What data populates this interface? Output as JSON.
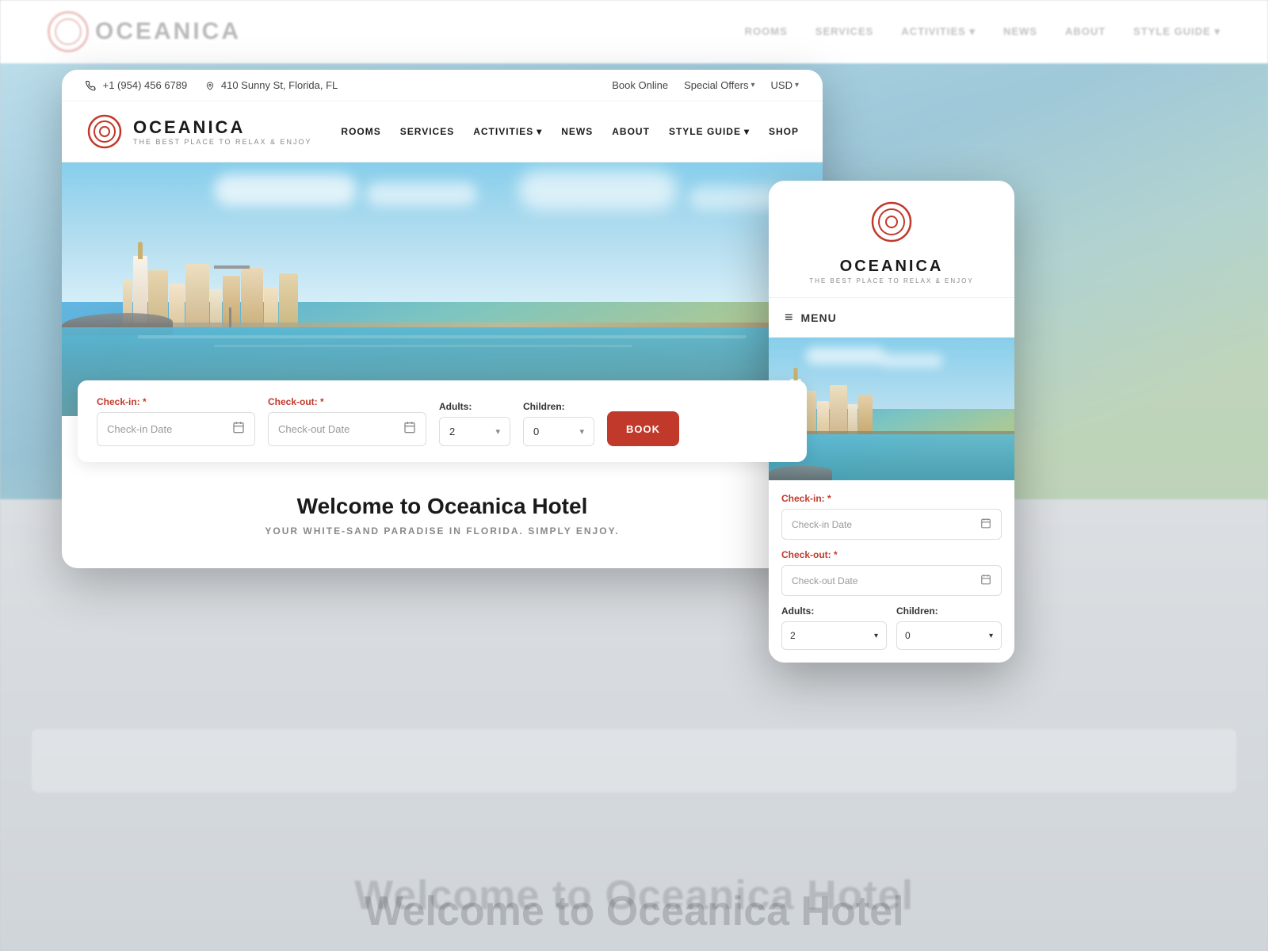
{
  "brand": {
    "name": "OCEANICA",
    "tagline": "THE BEST PLACE TO RELAX & ENJOY",
    "phone": "+1 (954) 456 6789",
    "address": "410 Sunny St, Florida, FL"
  },
  "topbar": {
    "book_online": "Book Online",
    "special_offers": "Special Offers",
    "currency": "USD"
  },
  "nav": {
    "items": [
      "ROOMS",
      "SERVICES",
      "ACTIVITIES",
      "NEWS",
      "ABOUT",
      "STYLE GUIDE",
      "SHOP"
    ],
    "dropdown_items": [
      "ACTIVITIES",
      "STYLE GUIDE"
    ]
  },
  "booking": {
    "checkin_label": "Check-in:",
    "checkin_required": "*",
    "checkin_placeholder": "Check-in Date",
    "checkout_label": "Check-out:",
    "checkout_required": "*",
    "checkout_placeholder": "Check-out Date",
    "adults_label": "Adults:",
    "adults_value": "2",
    "children_label": "Children:",
    "children_value": "0",
    "book_button": "BOOK"
  },
  "welcome": {
    "title": "Welcome to Oceanica Hotel",
    "subtitle": "YOUR WHITE-SAND PARADISE IN FLORIDA. SIMPLY ENJOY."
  },
  "mobile": {
    "menu_label": "MENU"
  },
  "background": {
    "nav_items": [
      "ROOMS",
      "SERVICES",
      "ACTIVITIES",
      "NEWS",
      "ABOUT",
      "STYLE GUIDE"
    ],
    "bottom_title": "Welcome to Oceanica Hotel"
  }
}
